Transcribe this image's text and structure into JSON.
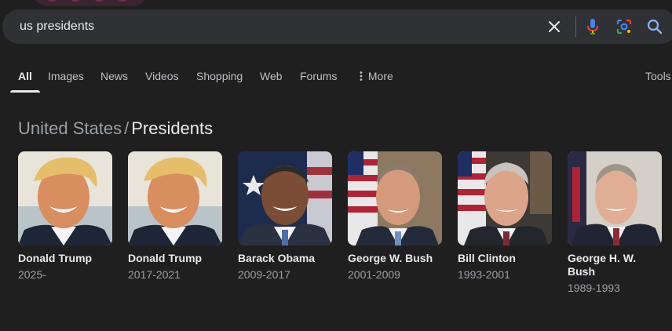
{
  "search": {
    "query": "us presidents"
  },
  "icons": {
    "clear": "close-icon",
    "voice": "microphone-icon",
    "lens": "camera-lens-icon",
    "search": "search-icon"
  },
  "tabs": [
    {
      "label": "All",
      "active": true
    },
    {
      "label": "Images"
    },
    {
      "label": "News"
    },
    {
      "label": "Videos"
    },
    {
      "label": "Shopping"
    },
    {
      "label": "Web"
    },
    {
      "label": "Forums"
    },
    {
      "label": "More",
      "icon": "vertical-dots-icon"
    },
    {
      "label": "Tools"
    }
  ],
  "breadcrumb": {
    "parent": "United States",
    "separator": "/",
    "current": "Presidents"
  },
  "presidents": [
    {
      "name": "Donald Trump",
      "years": "2025-"
    },
    {
      "name": "Donald Trump",
      "years": "2017-2021"
    },
    {
      "name": "Barack Obama",
      "years": "2009-2017"
    },
    {
      "name": "George W. Bush",
      "years": "2001-2009"
    },
    {
      "name": "Bill Clinton",
      "years": "1993-2001"
    },
    {
      "name": "George H. W. Bush",
      "years": "1989-1993"
    }
  ],
  "colors": {
    "background": "#1f1f1f",
    "search_bg": "#303134",
    "text": "#e8eaed",
    "muted": "#9aa0a6"
  }
}
